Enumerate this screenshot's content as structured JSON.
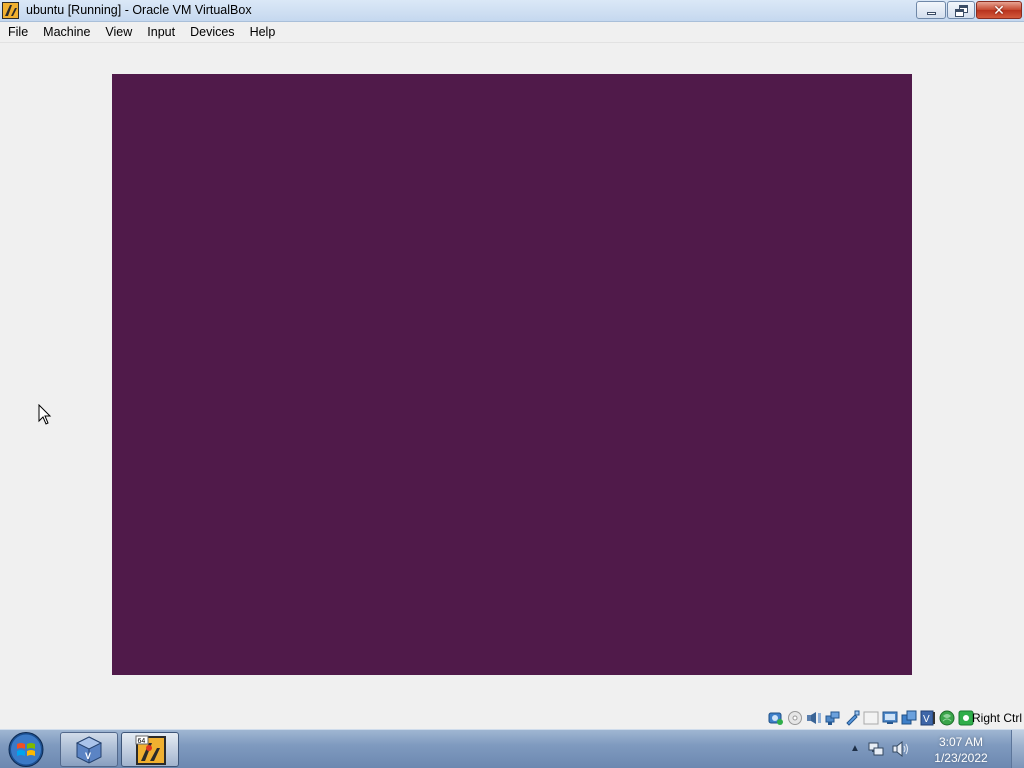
{
  "window": {
    "title": "ubuntu [Running] - Oracle VM VirtualBox",
    "close_glyph": "✕"
  },
  "menu": [
    "File",
    "Machine",
    "View",
    "Input",
    "Devices",
    "Help"
  ],
  "vm_screen": {
    "color": "#501a4a"
  },
  "status_bar": {
    "icons": [
      "hard-disk-icon",
      "optical-drive-icon",
      "audio-icon",
      "network-icon",
      "usb-icon",
      "shared-folders-icon",
      "display-icon",
      "video-capture-icon",
      "vt-x-icon",
      "guest-additions-icon",
      "mouse-integration-icon"
    ],
    "host_key": "Right Ctrl"
  },
  "taskbar": {
    "items": [
      "virtualbox-manager",
      "virtualbox-vm-window"
    ],
    "vm_badge": "64",
    "time": "3:07 AM",
    "date": "1/23/2022",
    "tray_arrow": "▲"
  }
}
